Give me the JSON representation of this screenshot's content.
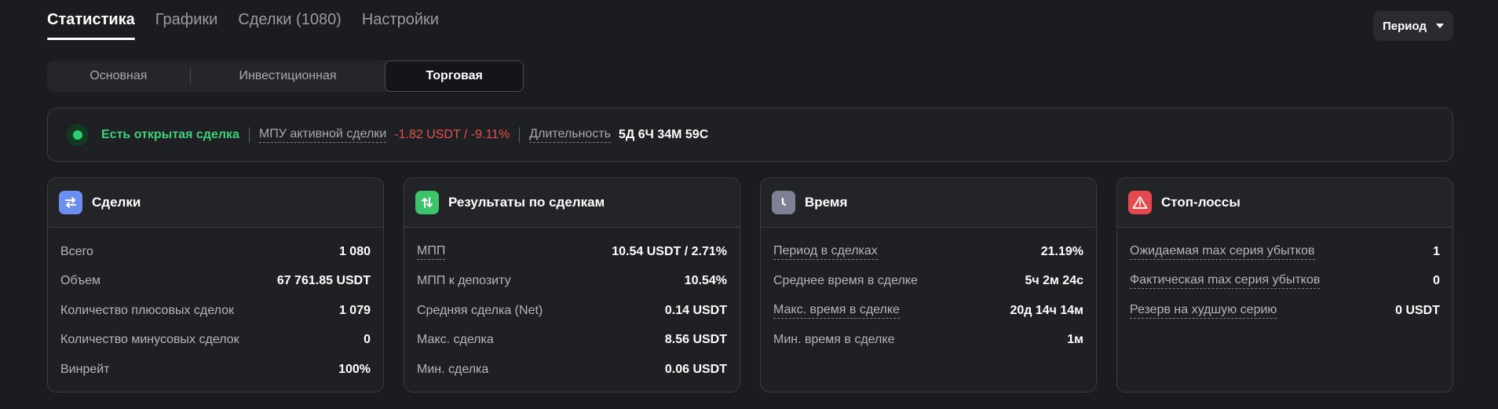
{
  "tabs": [
    {
      "label": "Статистика"
    },
    {
      "label": "Графики"
    },
    {
      "label": "Сделки (1080)"
    },
    {
      "label": "Настройки"
    }
  ],
  "period_label": "Период",
  "segments": [
    {
      "label": "Основная"
    },
    {
      "label": "Инвестиционная"
    },
    {
      "label": "Торговая"
    }
  ],
  "open_trade": {
    "status": "Есть открытая сделка",
    "mpu_label": "МПУ активной сделки",
    "mpu_value": "-1.82 USDT / -9.11%",
    "duration_label": "Длительность",
    "duration_value": "5Д 6Ч 34М 59С",
    "status_color": "#3ecf7a",
    "negative_color": "#e5534b"
  },
  "cards": {
    "deals": {
      "title": "Сделки",
      "icon": "swap-arrows-icon",
      "icon_color": "#6b8ff0",
      "rows": [
        {
          "label": "Всего",
          "value": "1 080"
        },
        {
          "label": "Объем",
          "value": "67 761.85 USDT"
        },
        {
          "label": "Количество плюсовых сделок",
          "value": "1 079"
        },
        {
          "label": "Количество минусовых сделок",
          "value": "0"
        },
        {
          "label": "Винрейт",
          "value": "100%"
        }
      ]
    },
    "results": {
      "title": "Результаты по сделкам",
      "icon": "up-down-arrows-icon",
      "icon_color": "#3cc46a",
      "rows": [
        {
          "label": "МПП",
          "value": "10.54 USDT / 2.71%"
        },
        {
          "label": "МПП к депозиту",
          "value": "10.54%"
        },
        {
          "label": "Средняя сделка (Net)",
          "value": "0.14 USDT"
        },
        {
          "label": "Макс. сделка",
          "value": "8.56 USDT"
        },
        {
          "label": "Мин. сделка",
          "value": "0.06 USDT"
        }
      ]
    },
    "time": {
      "title": "Время",
      "icon": "clock-icon",
      "icon_color": "#7c8196",
      "rows": [
        {
          "label": "Период в сделках",
          "value": "21.19%"
        },
        {
          "label": "Среднее время в сделке",
          "value": "5ч 2м 24с"
        },
        {
          "label": "Макс. время в сделке",
          "value": "20д 14ч 14м"
        },
        {
          "label": "Мин. время в сделке",
          "value": "1м"
        }
      ]
    },
    "stoploss": {
      "title": "Стоп-лоссы",
      "icon": "warning-triangle-icon",
      "icon_color": "#e5484d",
      "rows": [
        {
          "label": "Ожидаемая max серия убытков",
          "value": "1"
        },
        {
          "label": "Фактическая max серия убытков",
          "value": "0"
        },
        {
          "label": "Резерв на худшую серию",
          "value": "0 USDT"
        }
      ]
    }
  }
}
